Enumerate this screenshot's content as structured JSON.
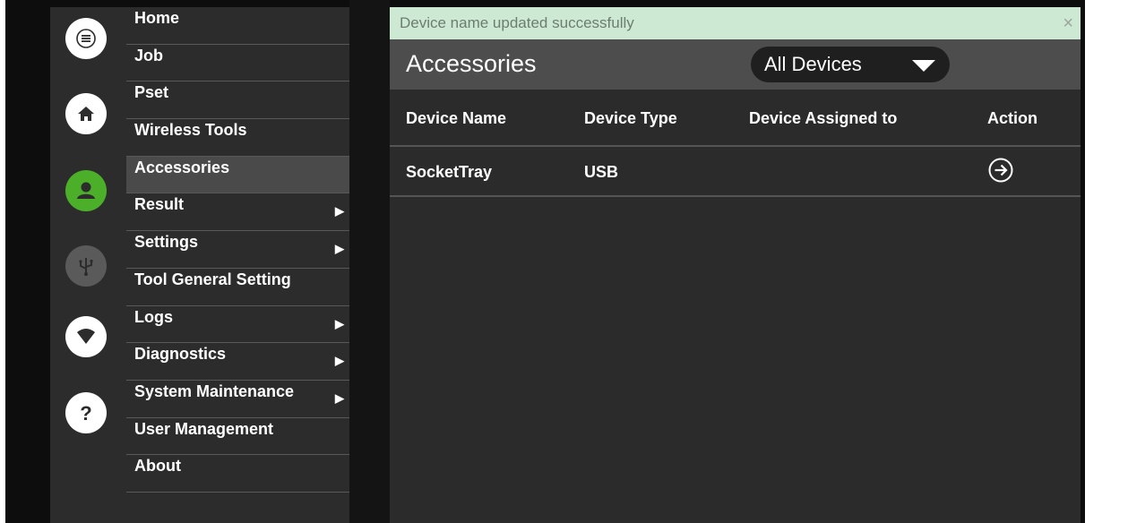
{
  "notification": {
    "message": "Device name updated successfully",
    "close_label": "×"
  },
  "rail": {
    "icons": [
      "menu-icon",
      "home-icon",
      "user-icon",
      "usb-icon",
      "wifi-icon",
      "help-icon"
    ],
    "active_color": "#4caf2a"
  },
  "menu": {
    "items": [
      {
        "label": "Home"
      },
      {
        "label": "Job"
      },
      {
        "label": "Pset"
      },
      {
        "label": "Wireless Tools"
      },
      {
        "label": "Accessories"
      },
      {
        "label": "Result"
      },
      {
        "label": "Settings"
      },
      {
        "label": "Tool General Setting"
      },
      {
        "label": "Logs"
      },
      {
        "label": "Diagnostics"
      },
      {
        "label": "System Maintenance"
      },
      {
        "label": "User Management"
      },
      {
        "label": "About"
      }
    ],
    "active": "Accessories"
  },
  "page": {
    "title": "Accessories",
    "filter": {
      "selected": "All Devices"
    }
  },
  "table": {
    "columns": [
      "Device Name",
      "Device Type",
      "Device Assigned to",
      "Action"
    ],
    "rows": [
      {
        "name": "SocketTray",
        "type": "USB",
        "assigned": ""
      }
    ]
  }
}
